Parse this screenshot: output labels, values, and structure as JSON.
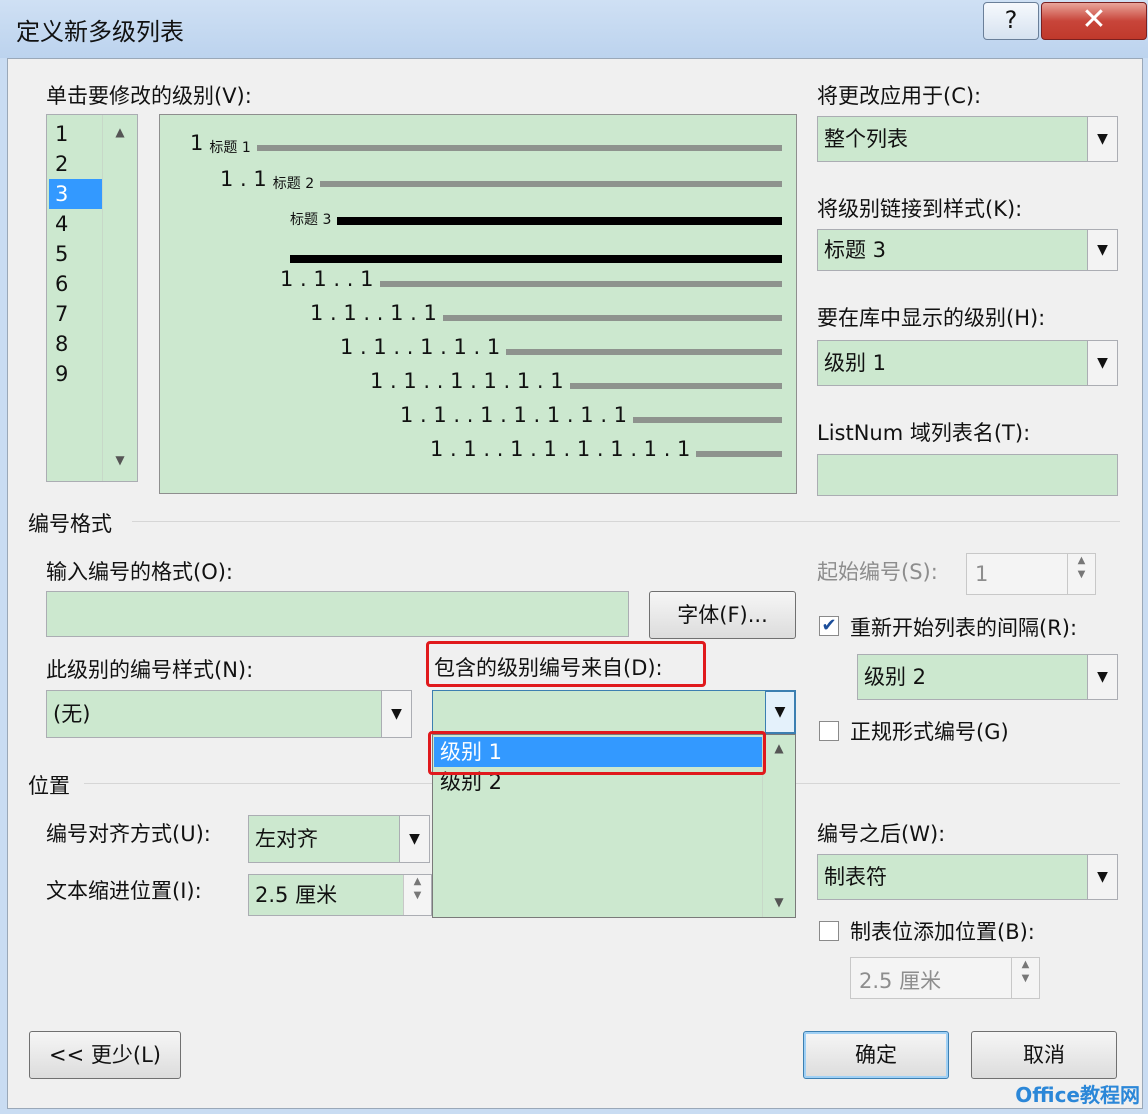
{
  "window": {
    "title": "定义新多级列表",
    "help": "?",
    "close": "✕"
  },
  "levels": {
    "label": "单击要修改的级别(V):",
    "items": [
      "1",
      "2",
      "3",
      "4",
      "5",
      "6",
      "7",
      "8",
      "9"
    ],
    "selected_index": 2
  },
  "preview": {
    "rows": [
      {
        "num": "1",
        "style": "标题 1"
      },
      {
        "num": "1.1",
        "style": "标题 2"
      },
      {
        "num": "",
        "style": "标题 3"
      },
      {
        "num": "",
        "style": ""
      },
      {
        "num": "1.1..1",
        "style": ""
      },
      {
        "num": "1.1..1.1",
        "style": ""
      },
      {
        "num": "1.1..1.1.1",
        "style": ""
      },
      {
        "num": "1.1..1.1.1.1",
        "style": ""
      },
      {
        "num": "1.1..1.1.1.1.1",
        "style": ""
      },
      {
        "num": "1.1..1.1.1.1.1.1",
        "style": ""
      }
    ]
  },
  "right_panel": {
    "apply_to_label": "将更改应用于(C):",
    "apply_to_value": "整个列表",
    "link_style_label": "将级别链接到样式(K):",
    "link_style_value": "标题 3",
    "gallery_level_label": "要在库中显示的级别(H):",
    "gallery_level_value": "级别 1",
    "listnum_label": "ListNum 域列表名(T):",
    "listnum_value": ""
  },
  "number_format": {
    "section_title": "编号格式",
    "format_label": "输入编号的格式(O):",
    "format_value": "",
    "font_button": "字体(F)...",
    "style_label": "此级别的编号样式(N):",
    "style_value": "(无)",
    "include_label": "包含的级别编号来自(D):",
    "include_value": "",
    "include_options": [
      "级别 1",
      "级别 2"
    ],
    "include_selected_index": 0,
    "start_label": "起始编号(S):",
    "start_value": "1",
    "restart_label": "重新开始列表的间隔(R):",
    "restart_checked": true,
    "restart_value": "级别 2",
    "legal_label": "正规形式编号(G)",
    "legal_checked": false
  },
  "position": {
    "section_title": "位置",
    "align_label": "编号对齐方式(U):",
    "align_value": "左对齐",
    "indent_label": "文本缩进位置(I):",
    "indent_value": "2.5 厘米",
    "after_label": "编号之后(W):",
    "after_value": "制表符",
    "tab_add_label": "制表位添加位置(B):",
    "tab_add_checked": false,
    "tab_add_value": "2.5 厘米"
  },
  "footer": {
    "less_button": "<< 更少(L)",
    "ok_button": "确定",
    "cancel_button": "取消",
    "watermark": "Office教程网"
  },
  "colors": {
    "field_bg": "#cce8cf",
    "selection": "#3399ff",
    "highlight_box": "#e0191c"
  }
}
